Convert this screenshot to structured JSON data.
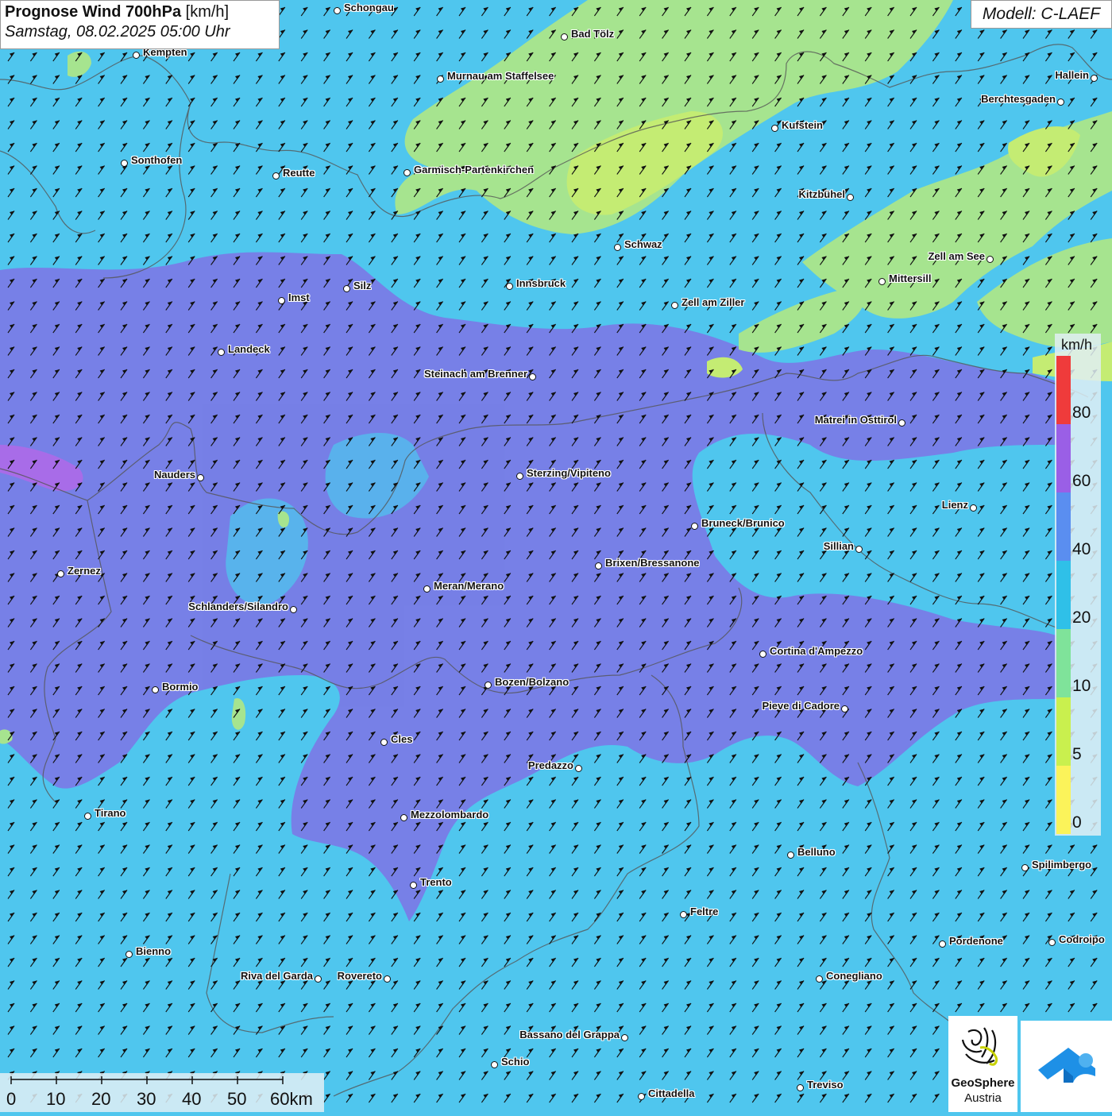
{
  "header": {
    "title_bold": "Prognose Wind 700hPa",
    "title_unit": "[km/h]",
    "datetime": "Samstag, 08.02.2025 05:00 Uhr",
    "model": "Modell: C-LAEF"
  },
  "legend": {
    "unit": "km/h",
    "labels": [
      "80",
      "60",
      "40",
      "20",
      "10",
      "5",
      "0"
    ],
    "colors": [
      "#ef3b3b",
      "#9a5fe6",
      "#5a8ef0",
      "#2fc0e8",
      "#7fe39a",
      "#c9f04e",
      "#fbf35a"
    ]
  },
  "scale_bar": {
    "labels": [
      "0",
      "10",
      "20",
      "30",
      "40",
      "50",
      "60km"
    ]
  },
  "logos": {
    "geosphere_line1": "GeoSphere",
    "geosphere_line2": "Austria"
  },
  "map": {
    "wind_direction": "south-southwest",
    "colors": {
      "background": "#4fc6ee",
      "strong": "#7b78e6",
      "green": "#a6e48f",
      "yellow_green": "#c4ec73",
      "purple": "#a86ce8"
    },
    "cities": [
      {
        "name": "Schongau",
        "label_pos": "right"
      },
      {
        "name": "Kempten",
        "label_pos": "right"
      },
      {
        "name": "Bad Tölz",
        "label_pos": "right"
      },
      {
        "name": "Murnau am Staffelsee",
        "label_pos": "right"
      },
      {
        "name": "Hallein",
        "label_pos": "left"
      },
      {
        "name": "Berchtesgaden",
        "label_pos": "left"
      },
      {
        "name": "Kufstein",
        "label_pos": "right"
      },
      {
        "name": "Sonthofen",
        "label_pos": "right"
      },
      {
        "name": "Reutte",
        "label_pos": "right"
      },
      {
        "name": "Garmisch-Partenkirchen",
        "label_pos": "right"
      },
      {
        "name": "Kitzbühel",
        "label_pos": "left"
      },
      {
        "name": "Schwaz",
        "label_pos": "right"
      },
      {
        "name": "Zell am See",
        "label_pos": "left"
      },
      {
        "name": "Mittersill",
        "label_pos": "right"
      },
      {
        "name": "Innsbruck",
        "label_pos": "right"
      },
      {
        "name": "Imst",
        "label_pos": "right"
      },
      {
        "name": "Silz",
        "label_pos": "right"
      },
      {
        "name": "Zell am Ziller",
        "label_pos": "right"
      },
      {
        "name": "Landeck",
        "label_pos": "right"
      },
      {
        "name": "Steinach am Brenner",
        "label_pos": "left"
      },
      {
        "name": "Matrei in Osttirol",
        "label_pos": "left"
      },
      {
        "name": "Nauders",
        "label_pos": "left"
      },
      {
        "name": "Sterzing/Vipiteno",
        "label_pos": "right"
      },
      {
        "name": "Lienz",
        "label_pos": "left"
      },
      {
        "name": "Bruneck/Brunico",
        "label_pos": "right"
      },
      {
        "name": "Sillian",
        "label_pos": "left"
      },
      {
        "name": "Zernez",
        "label_pos": "right"
      },
      {
        "name": "Brixen/Bressanone",
        "label_pos": "right"
      },
      {
        "name": "Meran/Merano",
        "label_pos": "right"
      },
      {
        "name": "Schlanders/Silandro",
        "label_pos": "left"
      },
      {
        "name": "Cortina d'Ampezzo",
        "label_pos": "right"
      },
      {
        "name": "Bozen/Bolzano",
        "label_pos": "right"
      },
      {
        "name": "Bormio",
        "label_pos": "right"
      },
      {
        "name": "Pieve di Cadore",
        "label_pos": "left"
      },
      {
        "name": "Cles",
        "label_pos": "right"
      },
      {
        "name": "Predazzo",
        "label_pos": "left"
      },
      {
        "name": "Tirano",
        "label_pos": "right"
      },
      {
        "name": "Mezzolombardo",
        "label_pos": "right"
      },
      {
        "name": "Belluno",
        "label_pos": "right"
      },
      {
        "name": "Spilimbergo",
        "label_pos": "right"
      },
      {
        "name": "Trento",
        "label_pos": "right"
      },
      {
        "name": "Feltre",
        "label_pos": "right"
      },
      {
        "name": "Pordenone",
        "label_pos": "right"
      },
      {
        "name": "Codroipo",
        "label_pos": "right"
      },
      {
        "name": "Bienno",
        "label_pos": "right"
      },
      {
        "name": "Riva del Garda",
        "label_pos": "left"
      },
      {
        "name": "Rovereto",
        "label_pos": "left"
      },
      {
        "name": "Conegliano",
        "label_pos": "right"
      },
      {
        "name": "Bassano del Grappa",
        "label_pos": "left"
      },
      {
        "name": "Schio",
        "label_pos": "right"
      },
      {
        "name": "Treviso",
        "label_pos": "right"
      },
      {
        "name": "Cittadella",
        "label_pos": "right"
      }
    ]
  }
}
